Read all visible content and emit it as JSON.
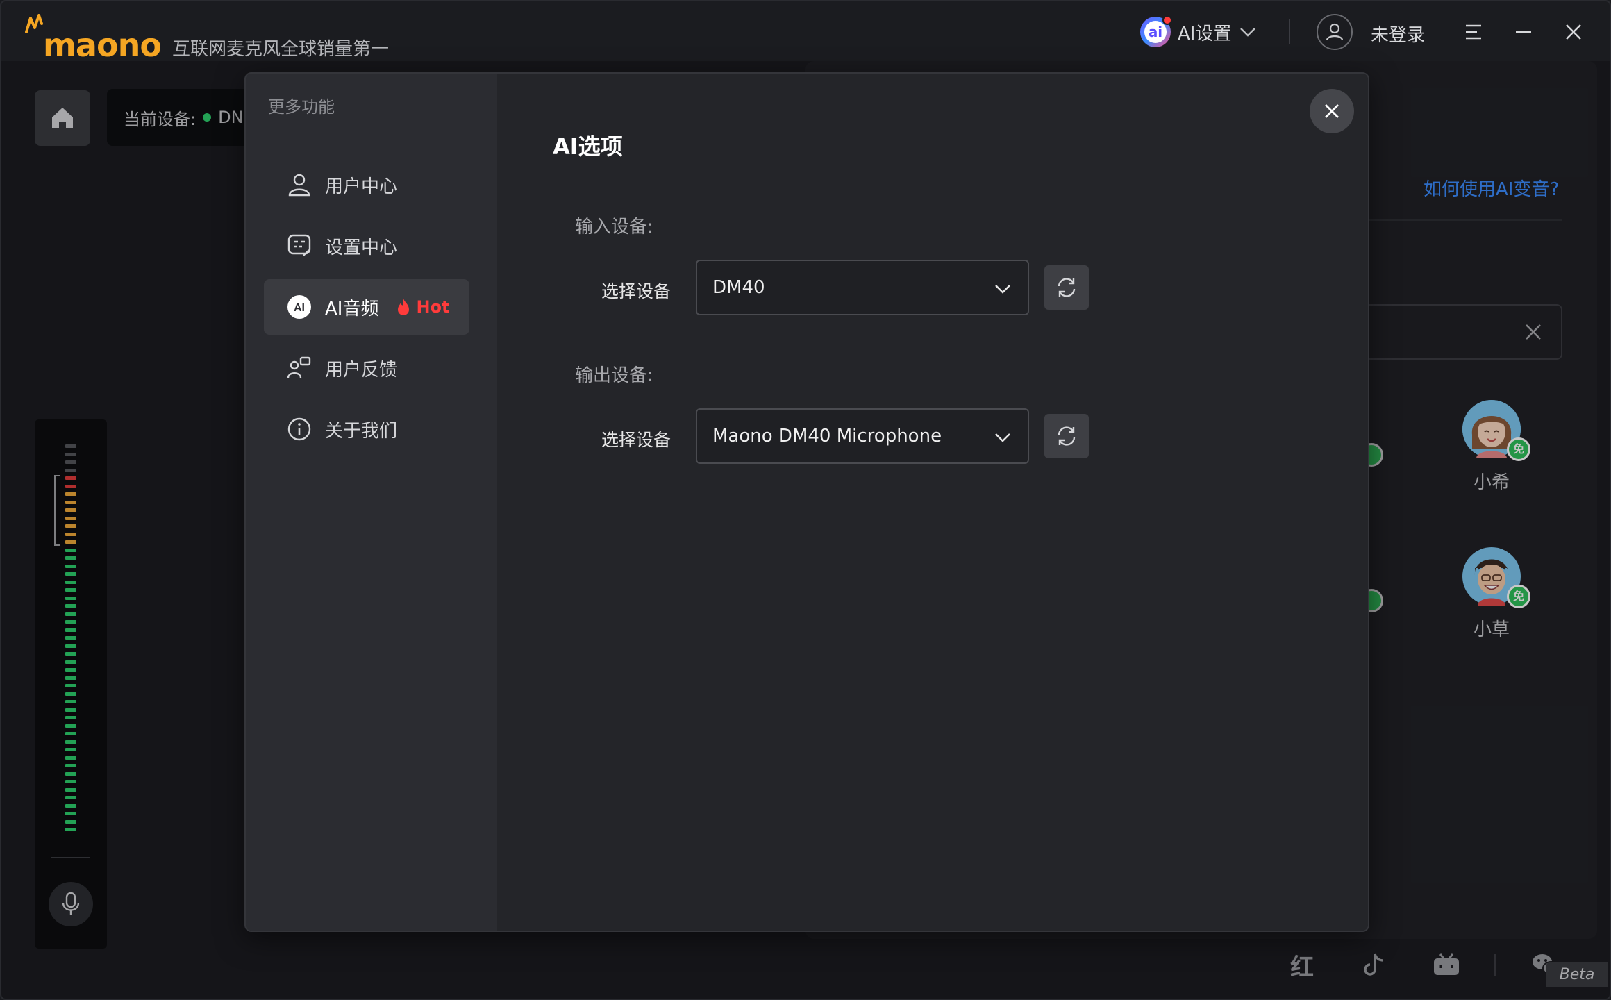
{
  "app": {
    "logo_text": "maono",
    "slogan": "互联网麦克风全球销量第一",
    "ai_settings_label": "AI设置",
    "ai_badge_text": "ai",
    "login_label": "未登录"
  },
  "background": {
    "device_prefix": "当前设备:",
    "device_value_partial": "DN",
    "help_link": "如何使用AI变音?",
    "voices": [
      {
        "name": "小希",
        "free_badge": "免"
      },
      {
        "name": "小草",
        "free_badge": "免"
      }
    ],
    "beta_label": "Beta",
    "footer_icons": [
      "xiaohongshu-icon",
      "douyin-icon",
      "bilibili-icon",
      "wechat-icon"
    ],
    "footer_xhs_text": "红"
  },
  "modal": {
    "sidebar_title": "更多功能",
    "menu": [
      {
        "label": "用户中心",
        "icon": "user-icon"
      },
      {
        "label": "设置中心",
        "icon": "settings-icon"
      },
      {
        "label": "AI音频",
        "icon": "ai-icon",
        "icon_text": "AI",
        "badge": "Hot",
        "active": true
      },
      {
        "label": "用户反馈",
        "icon": "feedback-icon"
      },
      {
        "label": "关于我们",
        "icon": "info-icon"
      }
    ],
    "title": "AI选项",
    "input_section": "输入设备:",
    "output_section": "输出设备:",
    "input_field_label": "选择设备",
    "output_field_label": "选择设备",
    "input_device": "DM40",
    "output_device": "Maono DM40 Microphone"
  },
  "colors": {
    "brand": "#f5a623",
    "accent_link": "#3b8cff",
    "hot": "#ff3b3b",
    "free_badge": "#2fbf5a"
  }
}
